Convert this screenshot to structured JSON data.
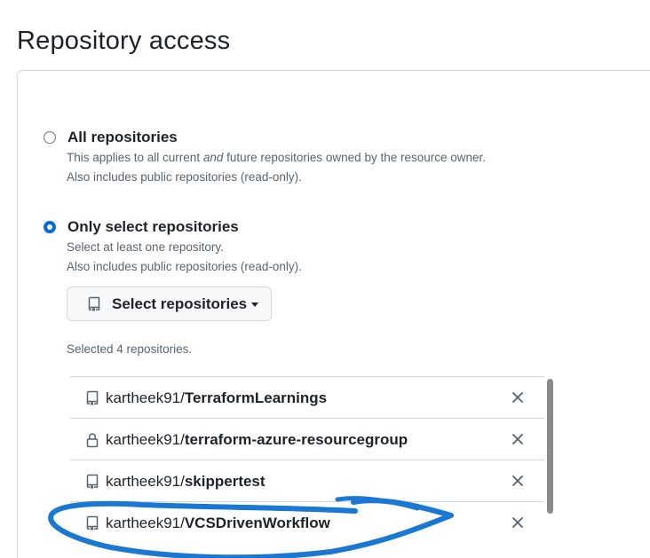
{
  "page": {
    "title": "Repository access"
  },
  "options": [
    {
      "label": "All repositories",
      "checked": false,
      "description_lines": [
        "This applies to all current and future repositories owned by the resource owner.",
        "Also includes public repositories (read-only)."
      ]
    },
    {
      "label": "Only select repositories",
      "checked": true,
      "description_lines": [
        "Select at least one repository.",
        "Also includes public repositories (read-only)."
      ]
    }
  ],
  "select_button": {
    "label": "Select repositories",
    "icon": "repo-icon"
  },
  "selected_count_text": "Selected 4 repositories.",
  "repositories": [
    {
      "owner": "kartheek91/",
      "name": "TerraformLearnings",
      "icon": "repo-icon"
    },
    {
      "owner": "kartheek91/",
      "name": "terraform-azure-resourcegroup",
      "icon": "lock-icon"
    },
    {
      "owner": "kartheek91/",
      "name": "skippertest",
      "icon": "repo-icon"
    },
    {
      "owner": "kartheek91/",
      "name": "VCSDrivenWorkflow",
      "icon": "repo-icon"
    }
  ],
  "colors": {
    "accent": "#0969da",
    "annotation": "#1a78d2",
    "border": "#d0d7de",
    "muted_text": "#59636e"
  }
}
